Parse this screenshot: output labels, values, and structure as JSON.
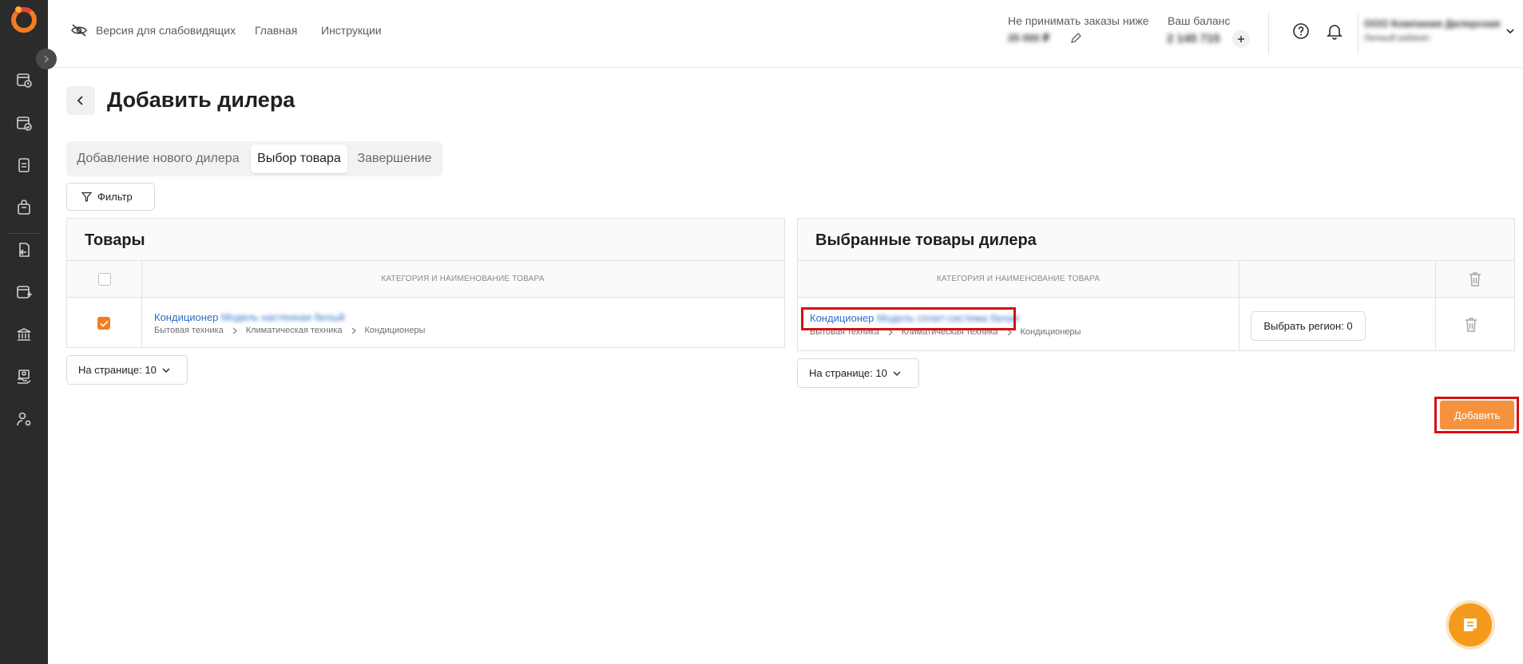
{
  "header": {
    "accessibility_label": "Версия для слабовидящих",
    "nav_home": "Главная",
    "nav_instructions": "Инструкции",
    "min_orders_label": "Не принимать заказы ниже",
    "min_orders_value": "25 000 ₽",
    "balance_label": "Ваш баланс",
    "balance_value": "2 145 715",
    "user_name": "ООО Компания Дилерская",
    "user_sub": "Личный кабинет"
  },
  "page": {
    "title": "Добавить дилера",
    "tabs": [
      {
        "label": "Добавление нового дилера",
        "active": false
      },
      {
        "label": "Выбор товара",
        "active": true
      },
      {
        "label": "Завершение",
        "active": false
      }
    ],
    "filter_label": "Фильтр"
  },
  "products_panel": {
    "title": "Товары",
    "column_header": "Категория и наименование товара",
    "rows": [
      {
        "name": "Кондиционер",
        "name_hidden": "Модель настенная белый",
        "checked": true,
        "breadcrumbs": [
          "Бытовая техника",
          "Климатическая техника",
          "Кондиционеры"
        ]
      }
    ],
    "per_page_label": "На странице: 10"
  },
  "selected_panel": {
    "title": "Выбранные товары дилера",
    "column_header": "Категория и наименование товара",
    "rows": [
      {
        "name": "Кондиционер",
        "name_hidden": "Модель сплит-система белая",
        "breadcrumbs": [
          "Бытовая техника",
          "Климатическая техника",
          "Кондиционеры"
        ],
        "region_button": "Выбрать регион: 0"
      }
    ],
    "per_page_label": "На странице: 10",
    "add_button": "Добавить"
  },
  "colors": {
    "accent": "#f6923f",
    "sidebar": "#2b2b2b",
    "link": "#2f6ec4",
    "highlight": "#d80f16"
  }
}
